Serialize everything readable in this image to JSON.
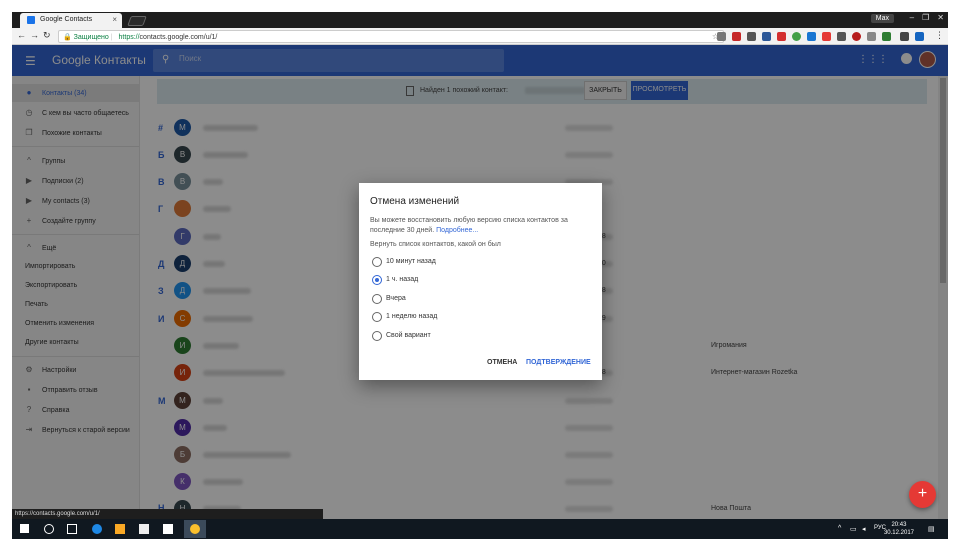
{
  "browser": {
    "tab_title": "Google Contacts",
    "tab_close": "×",
    "user_badge": "Max",
    "secure_label": "Защищено",
    "url_protocol": "https://",
    "url_rest": "contacts.google.com/u/1/",
    "status_url": "https://contacts.google.com/u/1/"
  },
  "app": {
    "title": "Google Контакты",
    "search_placeholder": "Поиск"
  },
  "sidebar": {
    "items": [
      {
        "label": "Контакты (34)",
        "icon": "person-icon",
        "active": true
      },
      {
        "label": "С кем вы часто общаетесь",
        "icon": "history-icon"
      },
      {
        "label": "Похожие контакты",
        "icon": "copy-icon"
      }
    ],
    "groups_header": "Группы",
    "groups": [
      {
        "label": "Подписки (2)",
        "icon": "label-icon"
      },
      {
        "label": "My contacts (3)",
        "icon": "label-icon"
      },
      {
        "label": "Создайте группу",
        "icon": "plus-icon"
      }
    ],
    "more_header": "Ещё",
    "more": [
      "Импортировать",
      "Экспортировать",
      "Печать",
      "Отменить изменения",
      "Другие контакты"
    ],
    "bottom": [
      {
        "label": "Настройки",
        "icon": "gear-icon"
      },
      {
        "label": "Отправить отзыв",
        "icon": "feedback-icon"
      },
      {
        "label": "Справка",
        "icon": "help-icon"
      },
      {
        "label": "Вернуться к старой версии",
        "icon": "exit-icon"
      }
    ]
  },
  "banner": {
    "text": "Найден 1 похожий контакт:",
    "close_label": "ЗАКРЫТЬ",
    "view_label": "ПРОСМОТРЕТЬ"
  },
  "contacts": [
    {
      "letter": "#",
      "initial": "M",
      "color": "#1e5aa8",
      "phone_tail": "",
      "company": ""
    },
    {
      "letter": "Б",
      "initial": "В",
      "color": "#37474f",
      "phone_tail": "",
      "company": ""
    },
    {
      "letter": "В",
      "initial": "В",
      "color": "#78909c",
      "phone_tail": "",
      "company": ""
    },
    {
      "letter": "Г",
      "initial": "",
      "color": "#e07b39",
      "phone_tail": "",
      "company": ""
    },
    {
      "letter": "",
      "initial": "Г",
      "color": "#5c6bc0",
      "phone_tail": "98",
      "company": ""
    },
    {
      "letter": "Д",
      "initial": "Д",
      "color": "#1a3e6e",
      "phone_tail": "70",
      "company": ""
    },
    {
      "letter": "З",
      "initial": "Д",
      "color": "#2196f3",
      "phone_tail": "78",
      "company": ""
    },
    {
      "letter": "И",
      "initial": "С",
      "color": "#ef6c00",
      "phone_tail": "69",
      "company": ""
    },
    {
      "letter": "",
      "initial": "И",
      "color": "#2e7d32",
      "phone_tail": "",
      "company": "Игромания"
    },
    {
      "letter": "",
      "initial": "И",
      "color": "#d84315",
      "phone_tail": "08",
      "company": "Интернет-магазин Rozetka"
    },
    {
      "letter": "М",
      "initial": "М",
      "color": "#5d4037",
      "phone_tail": "",
      "company": ""
    },
    {
      "letter": "",
      "initial": "М",
      "color": "#512da8",
      "phone_tail": "",
      "company": ""
    },
    {
      "letter": "",
      "initial": "Б",
      "color": "#8d6e63",
      "phone_tail": "",
      "company": ""
    },
    {
      "letter": "",
      "initial": "К",
      "color": "#7e57c2",
      "phone_tail": "",
      "company": ""
    },
    {
      "letter": "Н",
      "initial": "Н",
      "color": "#37474f",
      "phone_tail": "",
      "company": "Нова Пошта"
    }
  ],
  "dialog": {
    "title": "Отмена изменений",
    "description": "Вы можете восстановить любую версию списка контактов за последние 30 дней.",
    "link": "Подробнее...",
    "subtitle": "Вернуть список контактов, какой он был",
    "options": [
      {
        "label": "10 минут назад",
        "checked": false
      },
      {
        "label": "1 ч. назад",
        "checked": true
      },
      {
        "label": "Вчера",
        "checked": false
      },
      {
        "label": "1 неделю назад",
        "checked": false
      },
      {
        "label": "Свой вариант",
        "checked": false
      }
    ],
    "cancel_label": "ОТМЕНА",
    "confirm_label": "ПОДТВЕРЖДЕНИЕ"
  },
  "fab": {
    "label": "+"
  },
  "taskbar": {
    "lang": "РУС",
    "time": "20:43",
    "date": "30.12.2017"
  }
}
